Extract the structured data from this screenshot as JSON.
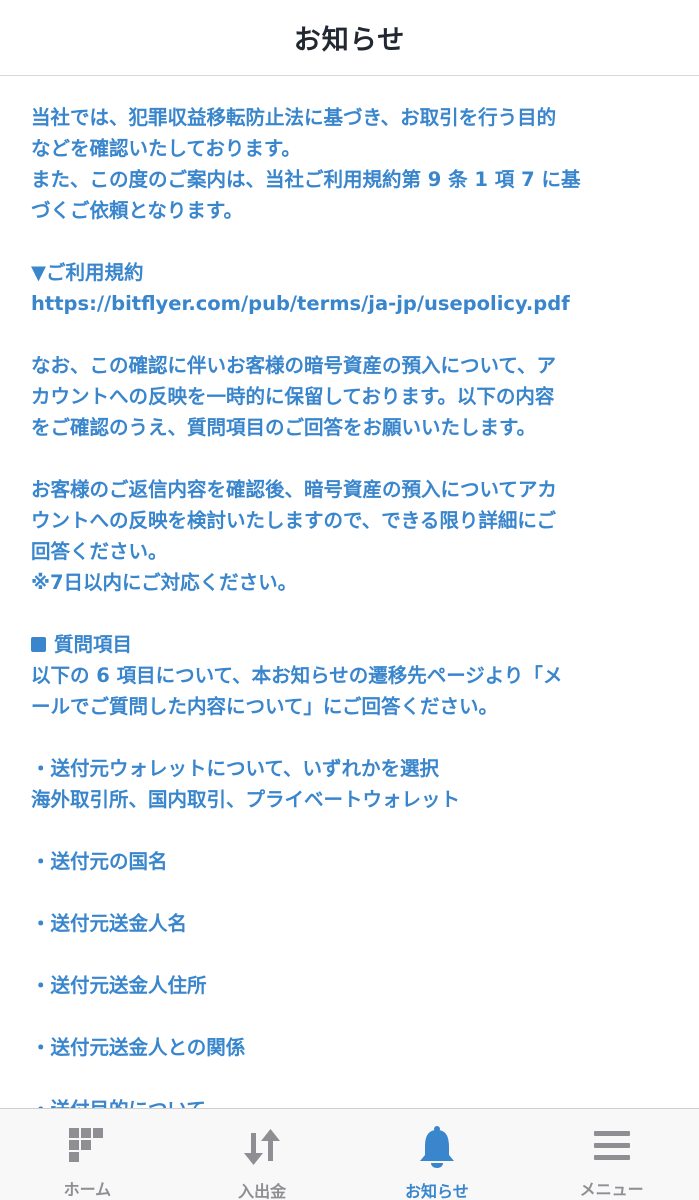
{
  "header": {
    "title": "お知らせ"
  },
  "content": {
    "lines": [
      "当社では、犯罪収益移転防止法に基づき、お取引を行う目的",
      "などを確認いたしております。",
      "また、この度のご案内は、当社ご利用規約第 9 条 1 項 7 に基",
      "づくご依頼となります。",
      "",
      "▼ご利用規約",
      "https://bitflyer.com/pub/terms/ja-jp/usepolicy.pdf",
      "",
      "なお、この確認に伴いお客様の暗号資産の預入について、ア",
      "カウントへの反映を一時的に保留しております。以下の内容",
      "をご確認のうえ、質問項目のご回答をお願いいたします。",
      "",
      "お客様のご返信内容を確認後、暗号資産の預入についてアカ",
      "ウントへの反映を検討いたしますので、できる限り詳細にご",
      "回答ください。",
      "※7日以内にご対応ください。",
      "",
      "質問項目",
      "以下の 6 項目について、本お知らせの遷移先ページより「メ",
      "ールでご質問した内容について」にご回答ください。",
      "",
      "・送付元ウォレットについて、いずれかを選択",
      "海外取引所、国内取引、プライベートウォレット",
      "",
      "・送付元の国名",
      "",
      "・送付元送金人名",
      "",
      "・送付元送金人住所",
      "",
      "・送付元送金人との関係",
      "",
      "・送付目的について"
    ]
  },
  "tabbar": {
    "items": [
      {
        "label": "ホーム",
        "icon": "home-grid-icon",
        "active": false
      },
      {
        "label": "入出金",
        "icon": "transfer-arrows-icon",
        "active": false
      },
      {
        "label": "お知らせ",
        "icon": "bell-icon",
        "active": true
      },
      {
        "label": "メニュー",
        "icon": "menu-icon",
        "active": false
      }
    ]
  },
  "colors": {
    "text_blue": "#3a86cd",
    "tab_inactive": "#8e8e93",
    "tab_active": "#3a86cd",
    "header_text": "#222831"
  }
}
